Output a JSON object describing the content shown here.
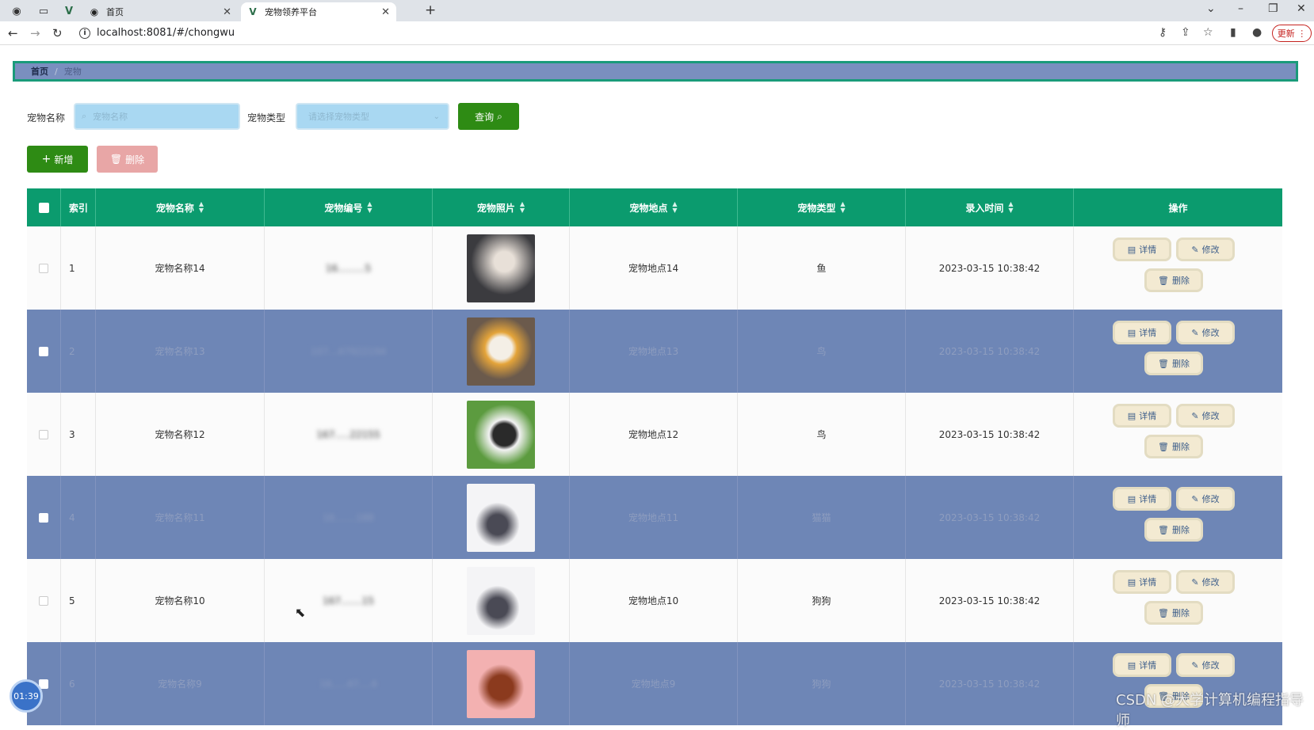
{
  "browser": {
    "tabs": [
      {
        "title": "首页",
        "icon": "globe-icon"
      },
      {
        "title": "宠物领养平台",
        "icon": "vue-icon"
      }
    ],
    "url": "localhost:8081/#/chongwu",
    "update_label": "更新"
  },
  "breadcrumb": {
    "home": "首页",
    "separator": "/",
    "current": "宠物"
  },
  "search": {
    "name_label": "宠物名称",
    "name_placeholder": "宠物名称",
    "type_label": "宠物类型",
    "type_placeholder": "请选择宠物类型",
    "query_label": "查询"
  },
  "toolbar": {
    "add_label": "新增",
    "delete_label": "删除"
  },
  "table": {
    "headers": {
      "index": "索引",
      "name": "宠物名称",
      "code": "宠物编号",
      "photo": "宠物照片",
      "location": "宠物地点",
      "type": "宠物类型",
      "time": "录入时间",
      "ops": "操作"
    },
    "op_labels": {
      "detail": "详情",
      "edit": "修改",
      "delete": "删除"
    },
    "rows": [
      {
        "index": "1",
        "name": "宠物名称14",
        "code": "16.........5",
        "location": "宠物地点14",
        "type": "鱼",
        "time": "2023-03-15 10:38:42"
      },
      {
        "index": "2",
        "name": "宠物名称13",
        "code": "107...47922194",
        "location": "宠物地点13",
        "type": "鸟",
        "time": "2023-03-15 10:38:42"
      },
      {
        "index": "3",
        "name": "宠物名称12",
        "code": "167.....22155",
        "location": "宠物地点12",
        "type": "鸟",
        "time": "2023-03-15 10:38:42"
      },
      {
        "index": "4",
        "name": "宠物名称11",
        "code": "16.......188",
        "location": "宠物地点11",
        "type": "猫猫",
        "time": "2023-03-15 10:38:42"
      },
      {
        "index": "5",
        "name": "宠物名称10",
        "code": "167.......15",
        "location": "宠物地点10",
        "type": "狗狗",
        "time": "2023-03-15 10:38:42"
      },
      {
        "index": "6",
        "name": "宠物名称9",
        "code": "16.....47....4",
        "location": "宠物地点9",
        "type": "狗狗",
        "time": "2023-03-15 10:38:42"
      }
    ]
  },
  "overlay": {
    "timer": "01:39",
    "watermark": "CSDN @大学计算机编程指导师"
  },
  "colors": {
    "header": "#0b9b6e",
    "stripe": "#6e86b6",
    "primary_green": "#2e8b14",
    "danger_light": "#e8a6a6",
    "op_button": "#f3ead2"
  }
}
